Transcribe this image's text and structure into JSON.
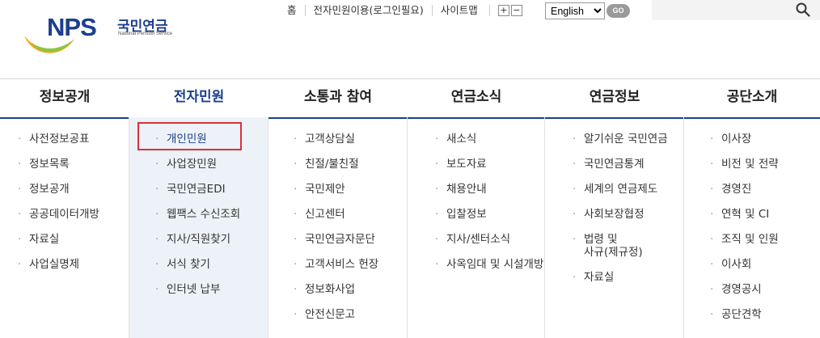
{
  "logo": {
    "mark": "NPS",
    "korean": "국민연금",
    "english": "National Pension Service"
  },
  "util": {
    "home": "홈",
    "login": "전자민원이용(로그인필요)",
    "sitemap": "사이트맵",
    "font_plus": "+",
    "font_minus": "−",
    "language": "English",
    "go": "GO"
  },
  "search": {
    "icon": "search-icon"
  },
  "nav": [
    {
      "label": "정보공개",
      "active": false
    },
    {
      "label": "전자민원",
      "active": true
    },
    {
      "label": "소통과 참여",
      "active": false
    },
    {
      "label": "연금소식",
      "active": false
    },
    {
      "label": "연금정보",
      "active": false
    },
    {
      "label": "공단소개",
      "active": false
    }
  ],
  "columns": [
    {
      "items": [
        "사전정보공표",
        "정보목록",
        "정보공개",
        "공공데이터개방",
        "자료실",
        "사업실명제"
      ]
    },
    {
      "items": [
        "개인민원",
        "사업장민원",
        "국민연금EDI",
        "웹팩스 수신조회",
        "지사/직원찾기",
        "서식 찾기",
        "인터넷 납부"
      ]
    },
    {
      "items": [
        "고객상담실",
        "친절/불친절",
        "국민제안",
        "신고센터",
        "국민연금자문단",
        "고객서비스 헌장",
        "정보화사업",
        "안전신문고"
      ]
    },
    {
      "items": [
        "새소식",
        "보도자료",
        "채용안내",
        "입찰정보",
        "지사/센터소식",
        "사옥임대 및 시설개방"
      ]
    },
    {
      "items": [
        "알기쉬운 국민연금",
        "국민연금통계",
        "세계의 연금제도",
        "사회보장협정",
        "법령 및\n사규(제규정)",
        "자료실"
      ]
    },
    {
      "items": [
        "이사장",
        "비전 및 전략",
        "경영진",
        "연혁 및 CI",
        "조직 및 인원",
        "이사회",
        "경영공시",
        "공단견학"
      ]
    }
  ],
  "colors": {
    "brand": "#1b3f88",
    "active_bg": "#edf2f8",
    "highlight": "#d9303b"
  }
}
